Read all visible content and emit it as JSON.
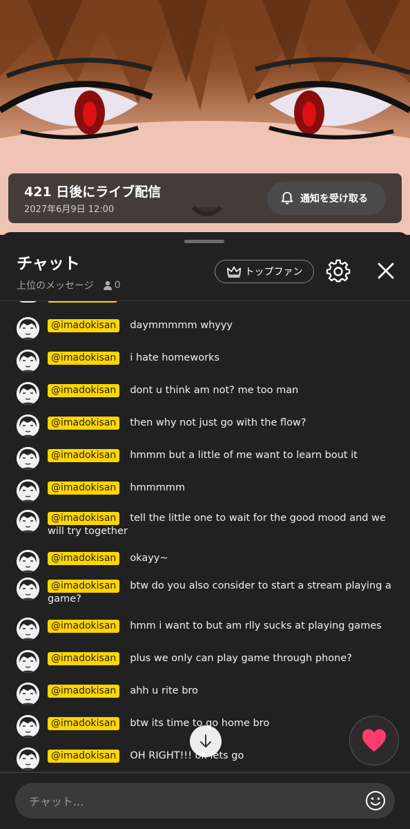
{
  "live_banner": {
    "title": "421 日後にライブ配信",
    "datetime": "2027年6月9日 12:00",
    "notify_label": "通知を受け取る"
  },
  "chat_header": {
    "title": "チャット",
    "subtitle": "上位のメッセージ",
    "viewer_count": "0",
    "top_fan_label": "トップファン"
  },
  "messages": [
    {
      "author": "@imadokisan",
      "text": "daymmmmm whyyy"
    },
    {
      "author": "@imadokisan",
      "text": "i hate homeworks"
    },
    {
      "author": "@imadokisan",
      "text": "dont u think am not? me too man"
    },
    {
      "author": "@imadokisan",
      "text": "then why not just go with the flow?"
    },
    {
      "author": "@imadokisan",
      "text": "hmmm but a little of me want to learn bout it"
    },
    {
      "author": "@imadokisan",
      "text": "hmmmmm"
    },
    {
      "author": "@imadokisan",
      "text": "tell the little one to wait for the good mood and we will try together"
    },
    {
      "author": "@imadokisan",
      "text": "okayy~"
    },
    {
      "author": "@imadokisan",
      "text": "btw do you also consider to start a stream playing a game?"
    },
    {
      "author": "@imadokisan",
      "text": "hmm i want to but am rlly sucks at playing games"
    },
    {
      "author": "@imadokisan",
      "text": "plus we only can play game through phone?"
    },
    {
      "author": "@imadokisan",
      "text": "ahh u rite bro"
    },
    {
      "author": "@imadokisan",
      "text": "btw its time to go home bro"
    },
    {
      "author": "@imadokisan",
      "text": "OH RIGHT!!! ok lets go"
    }
  ],
  "chat_input": {
    "placeholder": "チャット..."
  },
  "colors": {
    "author_tag": "#ffd600",
    "panel_bg": "#212121",
    "heart": "#ff3d6e"
  },
  "icons": [
    "bell-icon",
    "crown-icon",
    "gear-icon",
    "close-icon",
    "person-icon",
    "arrow-down-icon",
    "heart-icon",
    "emoji-icon"
  ]
}
